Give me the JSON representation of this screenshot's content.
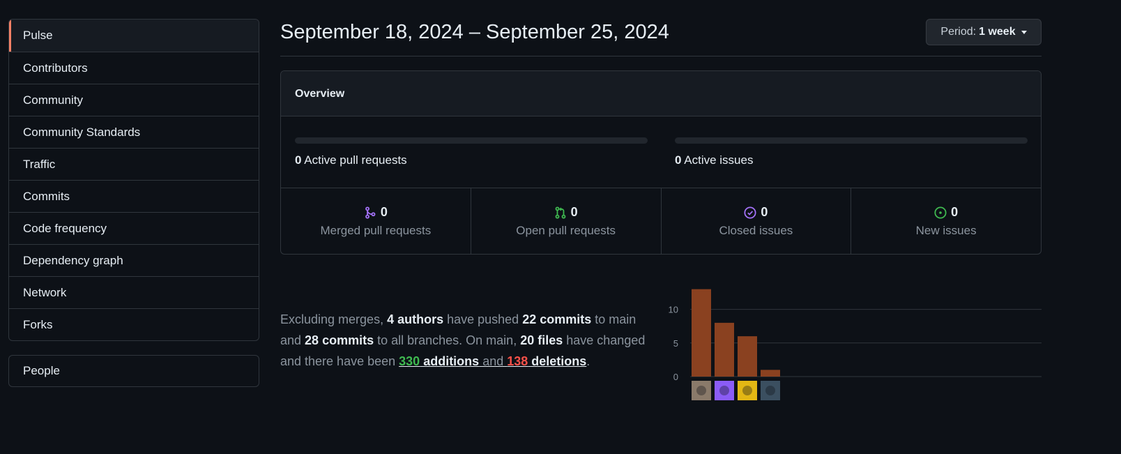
{
  "sidebar": {
    "items": [
      {
        "label": "Pulse",
        "selected": true
      },
      {
        "label": "Contributors"
      },
      {
        "label": "Community"
      },
      {
        "label": "Community Standards"
      },
      {
        "label": "Traffic"
      },
      {
        "label": "Commits"
      },
      {
        "label": "Code frequency"
      },
      {
        "label": "Dependency graph"
      },
      {
        "label": "Network"
      },
      {
        "label": "Forks"
      }
    ],
    "people_label": "People"
  },
  "header": {
    "title": "September 18, 2024 – September 25, 2024",
    "period_prefix": "Period:",
    "period_value": "1 week"
  },
  "overview": {
    "heading": "Overview",
    "active_prs": {
      "count": "0",
      "label": "Active pull requests",
      "fill_fraction": 0
    },
    "active_issues": {
      "count": "0",
      "label": "Active issues",
      "fill_fraction": 0
    },
    "stats": [
      {
        "count": "0",
        "label": "Merged pull requests",
        "icon": "git-merge-icon",
        "color": "#a371f7"
      },
      {
        "count": "0",
        "label": "Open pull requests",
        "icon": "git-pull-request-icon",
        "color": "#3fb950"
      },
      {
        "count": "0",
        "label": "Closed issues",
        "icon": "issue-closed-icon",
        "color": "#a371f7"
      },
      {
        "count": "0",
        "label": "New issues",
        "icon": "issue-opened-icon",
        "color": "#3fb950"
      }
    ]
  },
  "summary": {
    "t1": "Excluding merges, ",
    "authors": "4 authors",
    "t2": " have pushed ",
    "commits_main": "22 commits",
    "t3": " to main and ",
    "commits_all": "28 commits",
    "t4": " to all branches. On main, ",
    "files": "20 files",
    "t5": " have changed and there have been ",
    "additions_num": "330",
    "additions_word": " additions",
    "t6": " and ",
    "deletions_num": "138",
    "deletions_word": " deletions",
    "t7": "."
  },
  "chart_data": {
    "type": "bar",
    "categories": [
      "author-1",
      "author-2",
      "author-3",
      "author-4"
    ],
    "values": [
      13,
      8,
      6,
      1
    ],
    "yticks": [
      0,
      5,
      10
    ],
    "ylim": [
      0,
      14
    ],
    "grid": true,
    "bar_color": "#8a4120",
    "avatar_colors": [
      "#8a7a6a",
      "#8b5cf6",
      "#e2b714",
      "#3b4f60"
    ]
  }
}
